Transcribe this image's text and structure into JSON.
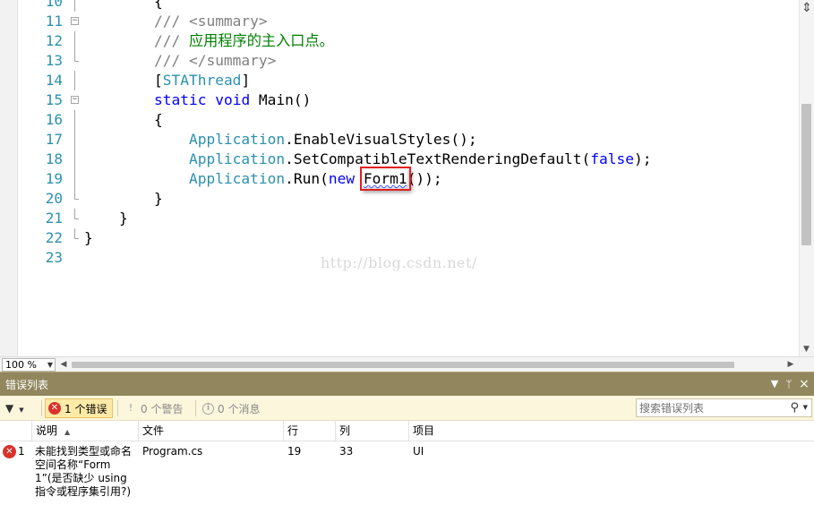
{
  "editor": {
    "lines": [
      {
        "num": "10",
        "fold": "line",
        "tokens": [
          {
            "t": "        {",
            "c": "plain"
          }
        ]
      },
      {
        "num": "11",
        "fold": "box",
        "tokens": [
          {
            "t": "        ",
            "c": "plain"
          },
          {
            "t": "/// ",
            "c": "doc"
          },
          {
            "t": "<summary>",
            "c": "doc"
          }
        ]
      },
      {
        "num": "12",
        "fold": "line",
        "tokens": [
          {
            "t": "        ",
            "c": "plain"
          },
          {
            "t": "/// ",
            "c": "doc"
          },
          {
            "t": "应用程序的主入口点。",
            "c": "cmt"
          }
        ]
      },
      {
        "num": "13",
        "fold": "end",
        "tokens": [
          {
            "t": "        ",
            "c": "plain"
          },
          {
            "t": "/// ",
            "c": "doc"
          },
          {
            "t": "</summary>",
            "c": "doc"
          }
        ]
      },
      {
        "num": "14",
        "fold": "line",
        "tokens": [
          {
            "t": "        ",
            "c": "plain"
          },
          {
            "t": "[",
            "c": "plain"
          },
          {
            "t": "STAThread",
            "c": "type"
          },
          {
            "t": "]",
            "c": "plain"
          }
        ]
      },
      {
        "num": "15",
        "fold": "box",
        "tokens": [
          {
            "t": "        ",
            "c": "plain"
          },
          {
            "t": "static",
            "c": "kw"
          },
          {
            "t": " ",
            "c": "plain"
          },
          {
            "t": "void",
            "c": "kw"
          },
          {
            "t": " Main()",
            "c": "plain"
          }
        ]
      },
      {
        "num": "16",
        "fold": "line",
        "tokens": [
          {
            "t": "        {",
            "c": "plain"
          }
        ]
      },
      {
        "num": "17",
        "fold": "line",
        "tokens": [
          {
            "t": "            ",
            "c": "plain"
          },
          {
            "t": "Application",
            "c": "type"
          },
          {
            "t": ".EnableVisualStyles();",
            "c": "plain"
          }
        ]
      },
      {
        "num": "18",
        "fold": "line",
        "tokens": [
          {
            "t": "            ",
            "c": "plain"
          },
          {
            "t": "Application",
            "c": "type"
          },
          {
            "t": ".SetCompatibleTextRenderingDefault(",
            "c": "plain"
          },
          {
            "t": "false",
            "c": "kw"
          },
          {
            "t": ");",
            "c": "plain"
          }
        ]
      },
      {
        "num": "19",
        "fold": "line",
        "tokens": [
          {
            "t": "            ",
            "c": "plain"
          },
          {
            "t": "Application",
            "c": "type"
          },
          {
            "t": ".Run(",
            "c": "plain"
          },
          {
            "t": "new",
            "c": "kw"
          },
          {
            "t": " ",
            "c": "plain"
          },
          {
            "t": "Form1",
            "c": "err-hl"
          },
          {
            "t": "());",
            "c": "plain"
          }
        ]
      },
      {
        "num": "20",
        "fold": "end",
        "tokens": [
          {
            "t": "        }",
            "c": "plain"
          }
        ]
      },
      {
        "num": "21",
        "fold": "end",
        "tokens": [
          {
            "t": "    }",
            "c": "plain"
          }
        ]
      },
      {
        "num": "22",
        "fold": "end",
        "tokens": [
          {
            "t": "}",
            "c": "plain"
          }
        ]
      },
      {
        "num": "23",
        "fold": "none",
        "tokens": [
          {
            "t": "",
            "c": "plain"
          }
        ]
      }
    ],
    "watermark": "http://blog.csdn.net/",
    "vscroll_split_icon": "⇕",
    "zoom_value": "100 %"
  },
  "error_list": {
    "title": "错误列表",
    "title_buttons": {
      "dropdown": "▼",
      "pin": "ᵖ",
      "close": "×"
    },
    "filter_glyph": "▼",
    "errors_label": "1 个错误",
    "warnings_label": "0 个警告",
    "messages_label": "0 个消息",
    "search_placeholder": "搜索错误列表",
    "columns": {
      "description": "说明",
      "file": "文件",
      "line": "行",
      "column": "列",
      "project": "项目"
    },
    "rows": [
      {
        "num": "1",
        "description": "未能找到类型或命名空间名称“Form1”(是否缺少 using 指令或程序集引用?)",
        "file": "Program.cs",
        "line": "19",
        "column": "33",
        "project": "UI"
      }
    ]
  },
  "colors": {
    "keyword": "#0000ff",
    "type": "#2b91af",
    "comment": "#008000",
    "doc": "#808080",
    "panel_title": "#91865e",
    "error_red": "#d9312b"
  }
}
